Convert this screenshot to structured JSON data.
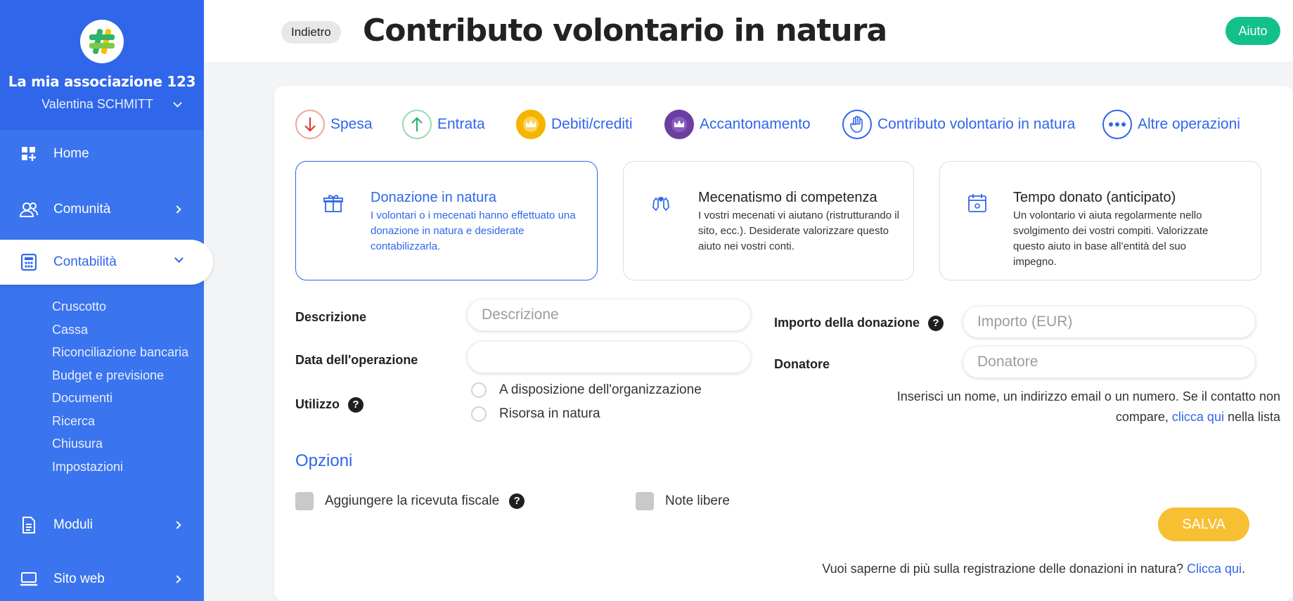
{
  "sidebar": {
    "org_name": "La mia associazione 123",
    "user_name": "Valentina SCHMITT",
    "nav": [
      {
        "label": "Home",
        "icon": "dashboard-icon"
      },
      {
        "label": "Comunità",
        "icon": "users-icon"
      },
      {
        "label": "Contabilità",
        "icon": "calculator-icon"
      },
      {
        "label": "Moduli",
        "icon": "document-icon"
      },
      {
        "label": "Sito web",
        "icon": "laptop-icon"
      }
    ],
    "sub_items": [
      "Cruscotto",
      "Cassa",
      "Riconciliazione bancaria",
      "Budget e previsione",
      "Documenti",
      "Ricerca",
      "Chiusura",
      "Impostazioni"
    ]
  },
  "header": {
    "back_label": "Indietro",
    "title": "Contributo volontario in natura",
    "help_label": "Aiuto"
  },
  "operation_tabs": [
    {
      "label": "Spesa",
      "icon": "arrow-down-icon",
      "color": "#e53935"
    },
    {
      "label": "Entrata",
      "icon": "arrow-up-icon",
      "color": "#2fb36a"
    },
    {
      "label": "Debiti/crediti",
      "icon": "crown-icon",
      "color": "#f5b400"
    },
    {
      "label": "Accantonamento",
      "icon": "crown-arrows-icon",
      "color": "#6b3fa0"
    },
    {
      "label": "Contributo volontario in natura",
      "icon": "hand-icon",
      "color": "#2f66ea"
    },
    {
      "label": "Altre operazioni",
      "icon": "more-icon",
      "color": "#2f66ea"
    }
  ],
  "types": [
    {
      "title": "Donazione in natura",
      "desc": "I volontari o i mecenati hanno effettuato una donazione in natura e desiderate contabilizzarla.",
      "icon": "gift-icon"
    },
    {
      "title": "Mecenatismo di competenza",
      "desc": "I vostri mecenati vi aiutano (ristrutturando il sito, ecc.). Desiderate valorizzare questo aiuto nei vostri conti.",
      "icon": "handshake-icon"
    },
    {
      "title": "Tempo donato (anticipato)",
      "desc": "Un volontario vi aiuta regolarmente nello svolgimento dei vostri compiti. Valorizzate questo aiuto in base all’entità del suo impegno.",
      "icon": "calendar-icon"
    }
  ],
  "form": {
    "description_label": "Descrizione",
    "description_placeholder": "Descrizione",
    "date_label": "Data dell'operazione",
    "date_value": "",
    "usage_label": "Utilizzo",
    "usage_options": [
      "A disposizione dell'organizzazione",
      "Risorsa in natura"
    ],
    "amount_label": "Importo della donazione",
    "amount_placeholder": "Importo (EUR)",
    "donor_label": "Donatore",
    "donor_placeholder": "Donatore",
    "donor_hint_before": "Inserisci un nome, un indirizzo email o un numero. Se il contatto non compare, ",
    "donor_hint_link": "clicca qui",
    "donor_hint_after": " nella lista"
  },
  "options": {
    "title": "Opzioni",
    "receipt_label": "Aggiungere la ricevuta fiscale",
    "notes_label": "Note libere"
  },
  "actions": {
    "save_label": "SALVA",
    "footer_text": "Vuoi saperne di più sulla registrazione delle donazioni in natura? ",
    "footer_link": "Clicca qui",
    "footer_end": "."
  },
  "colors": {
    "primary": "#2f66ea",
    "sidebar": "#3a74ee",
    "help": "#14c08a",
    "save": "#f7c033"
  }
}
